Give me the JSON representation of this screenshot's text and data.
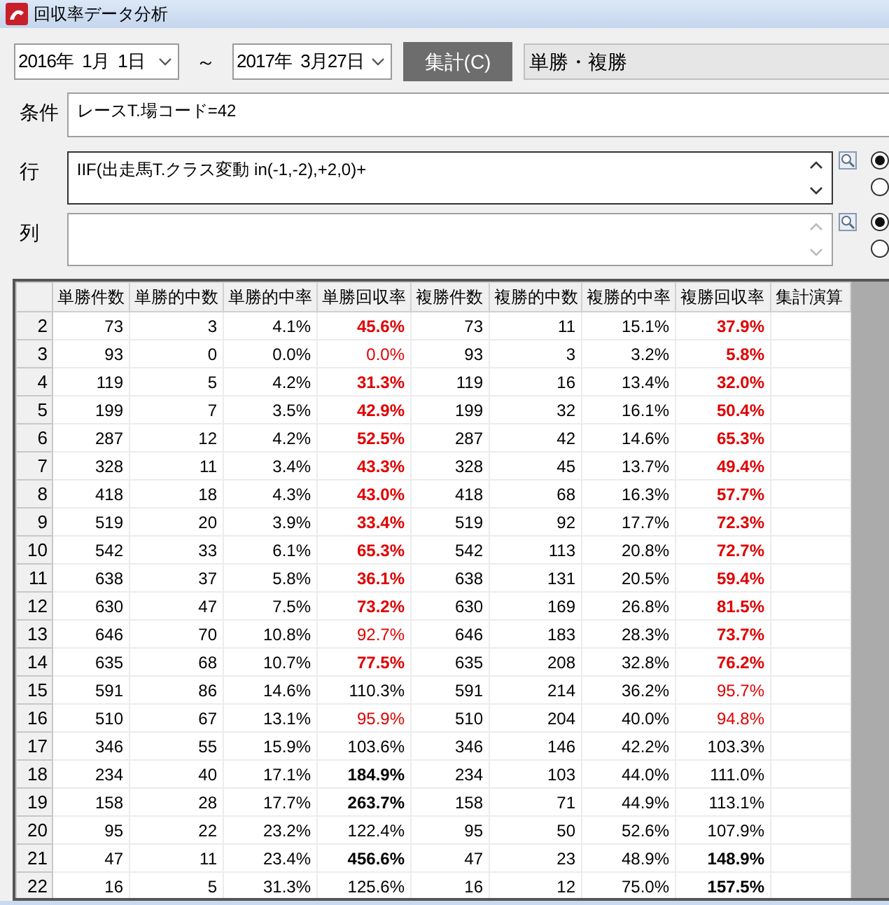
{
  "window": {
    "title": "回収率データ分析"
  },
  "toolbar": {
    "date_from": "2016年  1月  1日",
    "separator": "～",
    "date_to": "2017年  3月27日",
    "aggregate_button": "集計(C)",
    "bet_type": "単勝・複勝"
  },
  "condition": {
    "label": "条件",
    "value": "レースT.場コード=42"
  },
  "row_expr": {
    "label": "行",
    "value": "IIF(出走馬T.クラス変動 in(-1,-2),+2,0)+",
    "scroll_enabled": true,
    "radios": [
      {
        "selected": true
      },
      {
        "selected": false
      }
    ]
  },
  "col_expr": {
    "label": "列",
    "scroll_enabled": false,
    "radios": [
      {
        "selected": true
      },
      {
        "selected": false
      }
    ]
  },
  "table": {
    "columns": [
      "単勝件数",
      "単勝的中数",
      "単勝的中率",
      "単勝回収率",
      "複勝件数",
      "複勝的中数",
      "複勝的中率",
      "複勝回収率",
      "集計演算"
    ],
    "rows": [
      {
        "header": "2",
        "cells": [
          "73",
          "3",
          "4.1%",
          "45.6%",
          "73",
          "11",
          "15.1%",
          "37.9%"
        ],
        "styles": [
          {
            "red": true,
            "bold": true
          },
          {
            "red": true,
            "bold": true
          }
        ]
      },
      {
        "header": "3",
        "cells": [
          "93",
          "0",
          "0.0%",
          "0.0%",
          "93",
          "3",
          "3.2%",
          "5.8%"
        ],
        "styles": [
          {
            "red": true,
            "bold": false
          },
          {
            "red": true,
            "bold": true
          }
        ]
      },
      {
        "header": "4",
        "cells": [
          "119",
          "5",
          "4.2%",
          "31.3%",
          "119",
          "16",
          "13.4%",
          "32.0%"
        ],
        "styles": [
          {
            "red": true,
            "bold": true
          },
          {
            "red": true,
            "bold": true
          }
        ]
      },
      {
        "header": "5",
        "cells": [
          "199",
          "7",
          "3.5%",
          "42.9%",
          "199",
          "32",
          "16.1%",
          "50.4%"
        ],
        "styles": [
          {
            "red": true,
            "bold": true
          },
          {
            "red": true,
            "bold": true
          }
        ]
      },
      {
        "header": "6",
        "cells": [
          "287",
          "12",
          "4.2%",
          "52.5%",
          "287",
          "42",
          "14.6%",
          "65.3%"
        ],
        "styles": [
          {
            "red": true,
            "bold": true
          },
          {
            "red": true,
            "bold": true
          }
        ]
      },
      {
        "header": "7",
        "cells": [
          "328",
          "11",
          "3.4%",
          "43.3%",
          "328",
          "45",
          "13.7%",
          "49.4%"
        ],
        "styles": [
          {
            "red": true,
            "bold": true
          },
          {
            "red": true,
            "bold": true
          }
        ]
      },
      {
        "header": "8",
        "cells": [
          "418",
          "18",
          "4.3%",
          "43.0%",
          "418",
          "68",
          "16.3%",
          "57.7%"
        ],
        "styles": [
          {
            "red": true,
            "bold": true
          },
          {
            "red": true,
            "bold": true
          }
        ]
      },
      {
        "header": "9",
        "cells": [
          "519",
          "20",
          "3.9%",
          "33.4%",
          "519",
          "92",
          "17.7%",
          "72.3%"
        ],
        "styles": [
          {
            "red": true,
            "bold": true
          },
          {
            "red": true,
            "bold": true
          }
        ]
      },
      {
        "header": "10",
        "cells": [
          "542",
          "33",
          "6.1%",
          "65.3%",
          "542",
          "113",
          "20.8%",
          "72.7%"
        ],
        "styles": [
          {
            "red": true,
            "bold": true
          },
          {
            "red": true,
            "bold": true
          }
        ]
      },
      {
        "header": "11",
        "cells": [
          "638",
          "37",
          "5.8%",
          "36.1%",
          "638",
          "131",
          "20.5%",
          "59.4%"
        ],
        "styles": [
          {
            "red": true,
            "bold": true
          },
          {
            "red": true,
            "bold": true
          }
        ]
      },
      {
        "header": "12",
        "cells": [
          "630",
          "47",
          "7.5%",
          "73.2%",
          "630",
          "169",
          "26.8%",
          "81.5%"
        ],
        "styles": [
          {
            "red": true,
            "bold": true
          },
          {
            "red": true,
            "bold": true
          }
        ]
      },
      {
        "header": "13",
        "cells": [
          "646",
          "70",
          "10.8%",
          "92.7%",
          "646",
          "183",
          "28.3%",
          "73.7%"
        ],
        "styles": [
          {
            "red": true,
            "bold": false
          },
          {
            "red": true,
            "bold": true
          }
        ]
      },
      {
        "header": "14",
        "cells": [
          "635",
          "68",
          "10.7%",
          "77.5%",
          "635",
          "208",
          "32.8%",
          "76.2%"
        ],
        "styles": [
          {
            "red": true,
            "bold": true
          },
          {
            "red": true,
            "bold": true
          }
        ]
      },
      {
        "header": "15",
        "cells": [
          "591",
          "86",
          "14.6%",
          "110.3%",
          "591",
          "214",
          "36.2%",
          "95.7%"
        ],
        "styles": [
          {
            "red": false,
            "bold": false
          },
          {
            "red": true,
            "bold": false
          }
        ]
      },
      {
        "header": "16",
        "cells": [
          "510",
          "67",
          "13.1%",
          "95.9%",
          "510",
          "204",
          "40.0%",
          "94.8%"
        ],
        "styles": [
          {
            "red": true,
            "bold": false
          },
          {
            "red": true,
            "bold": false
          }
        ]
      },
      {
        "header": "17",
        "cells": [
          "346",
          "55",
          "15.9%",
          "103.6%",
          "346",
          "146",
          "42.2%",
          "103.3%"
        ],
        "styles": [
          {
            "red": false,
            "bold": false
          },
          {
            "red": false,
            "bold": false
          }
        ]
      },
      {
        "header": "18",
        "cells": [
          "234",
          "40",
          "17.1%",
          "184.9%",
          "234",
          "103",
          "44.0%",
          "111.0%"
        ],
        "styles": [
          {
            "red": false,
            "bold": true
          },
          {
            "red": false,
            "bold": false
          }
        ]
      },
      {
        "header": "19",
        "cells": [
          "158",
          "28",
          "17.7%",
          "263.7%",
          "158",
          "71",
          "44.9%",
          "113.1%"
        ],
        "styles": [
          {
            "red": false,
            "bold": true
          },
          {
            "red": false,
            "bold": false
          }
        ]
      },
      {
        "header": "20",
        "cells": [
          "95",
          "22",
          "23.2%",
          "122.4%",
          "95",
          "50",
          "52.6%",
          "107.9%"
        ],
        "styles": [
          {
            "red": false,
            "bold": false
          },
          {
            "red": false,
            "bold": false
          }
        ]
      },
      {
        "header": "21",
        "cells": [
          "47",
          "11",
          "23.4%",
          "456.6%",
          "47",
          "23",
          "48.9%",
          "148.9%"
        ],
        "styles": [
          {
            "red": false,
            "bold": true
          },
          {
            "red": false,
            "bold": true
          }
        ]
      },
      {
        "header": "22",
        "cells": [
          "16",
          "5",
          "31.3%",
          "125.6%",
          "16",
          "12",
          "75.0%",
          "157.5%"
        ],
        "styles": [
          {
            "red": false,
            "bold": false
          },
          {
            "red": false,
            "bold": true
          }
        ]
      }
    ]
  }
}
